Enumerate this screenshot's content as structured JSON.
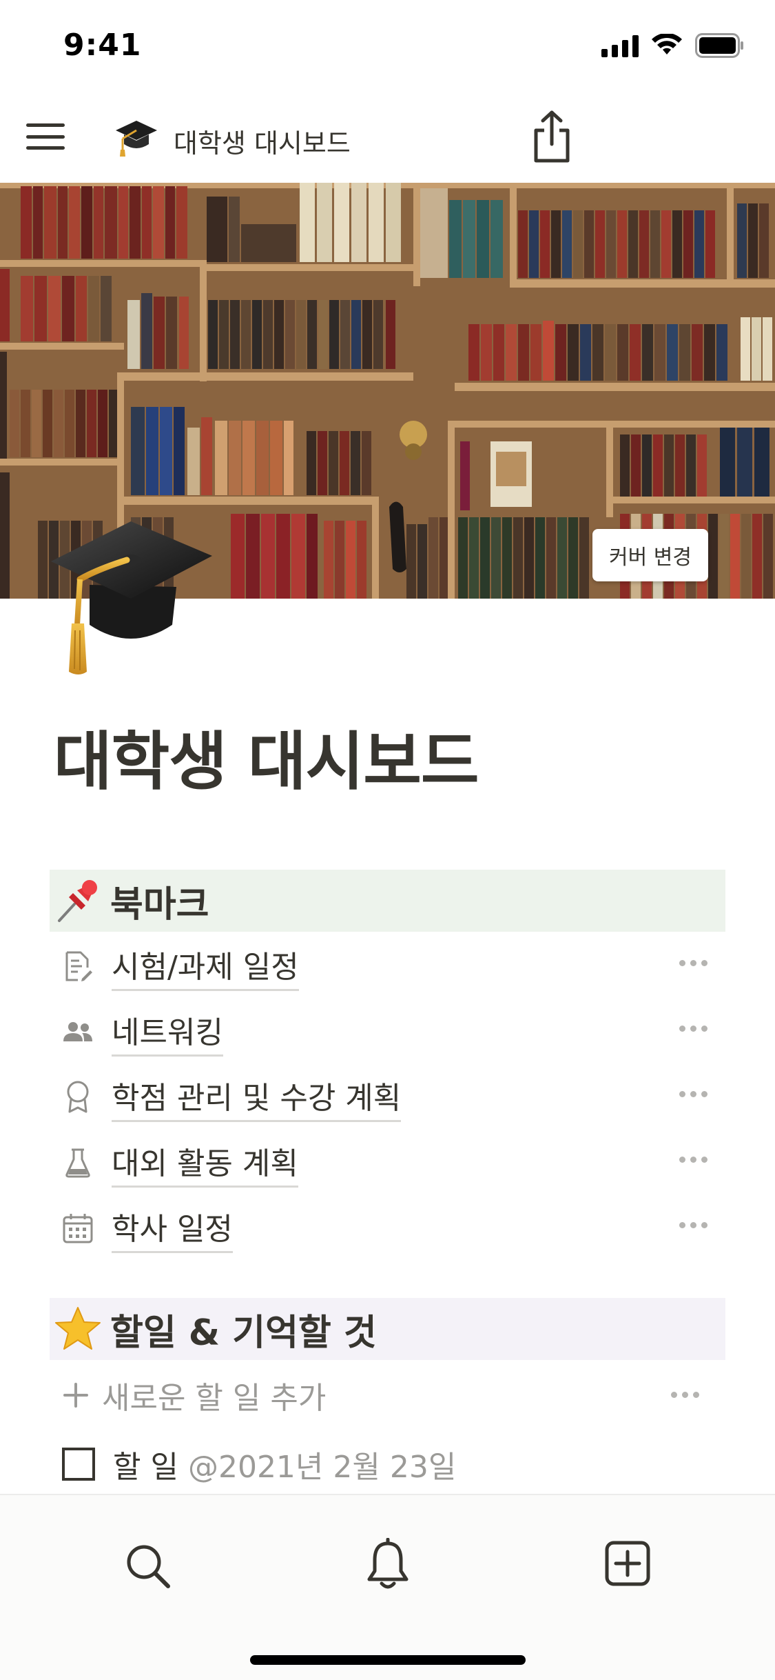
{
  "status_bar": {
    "time": "9:41"
  },
  "top_nav": {
    "title": "대학생 대시보드",
    "page_icon": "graduation-cap-icon"
  },
  "cover": {
    "change_cover_label": "커버 변경"
  },
  "page": {
    "title": "대학생 대시보드"
  },
  "bookmarks": {
    "header": "북마크",
    "header_icon": "pushpin-icon",
    "items": [
      {
        "label": "시험/과제 일정",
        "icon": "document-edit-icon"
      },
      {
        "label": "네트워킹",
        "icon": "people-icon"
      },
      {
        "label": "학점 관리 및 수강 계획",
        "icon": "award-ribbon-icon"
      },
      {
        "label": "대외 활동 계획",
        "icon": "flask-icon"
      },
      {
        "label": "학사 일정",
        "icon": "calendar-icon"
      }
    ]
  },
  "todos": {
    "header": "할일 & 기억할 것",
    "header_icon": "star-icon",
    "add_label": "새로운 할 일 추가",
    "items": [
      {
        "label": "할 일",
        "date": "@2021년 2월 23일",
        "checked": false
      }
    ]
  },
  "colors": {
    "text": "#37352f",
    "muted": "#9b9a97",
    "bookmarks_bg": "#edf3ec",
    "todos_bg": "#f4f2f8"
  },
  "bottom_bar": {
    "tabs": [
      "search-icon",
      "bell-icon",
      "new-page-icon"
    ]
  }
}
